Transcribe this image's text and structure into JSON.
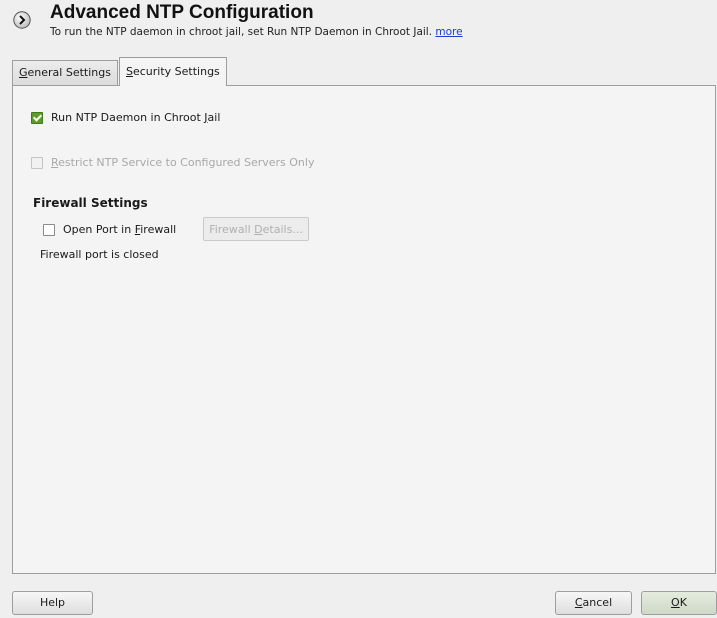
{
  "header": {
    "title": "Advanced NTP Configuration",
    "subtitle": "To run the NTP daemon in chroot jail, set Run NTP Daemon in Chroot Jail.",
    "more_link": "more"
  },
  "tabs": [
    {
      "label_pre": "",
      "mnemonic": "G",
      "label_post": "eneral Settings",
      "active": false
    },
    {
      "label_pre": "",
      "mnemonic": "S",
      "label_post": "ecurity Settings",
      "active": true
    }
  ],
  "security": {
    "chroot": {
      "label_pre": "Run NTP Daemon in Chroot ",
      "mnemonic": "J",
      "label_post": "ail",
      "checked": true,
      "enabled": true
    },
    "restrict": {
      "label_pre": "",
      "mnemonic": "R",
      "label_post": "estrict NTP Service to Configured Servers Only",
      "checked": false,
      "enabled": false
    },
    "firewall": {
      "title": "Firewall Settings",
      "open_port": {
        "label_pre": "Open Port in ",
        "mnemonic": "F",
        "label_post": "irewall",
        "checked": false
      },
      "details_btn": {
        "label_pre": "Firewall ",
        "mnemonic": "D",
        "label_post": "etails...",
        "enabled": false
      },
      "status": "Firewall port is closed"
    }
  },
  "buttons": {
    "help": "Help",
    "cancel": {
      "mnemonic": "C",
      "label_post": "ancel"
    },
    "ok": {
      "mnemonic": "O",
      "label_post": "K"
    }
  },
  "colors": {
    "link": "#1d3cd0",
    "check": "#5d9c2a"
  }
}
